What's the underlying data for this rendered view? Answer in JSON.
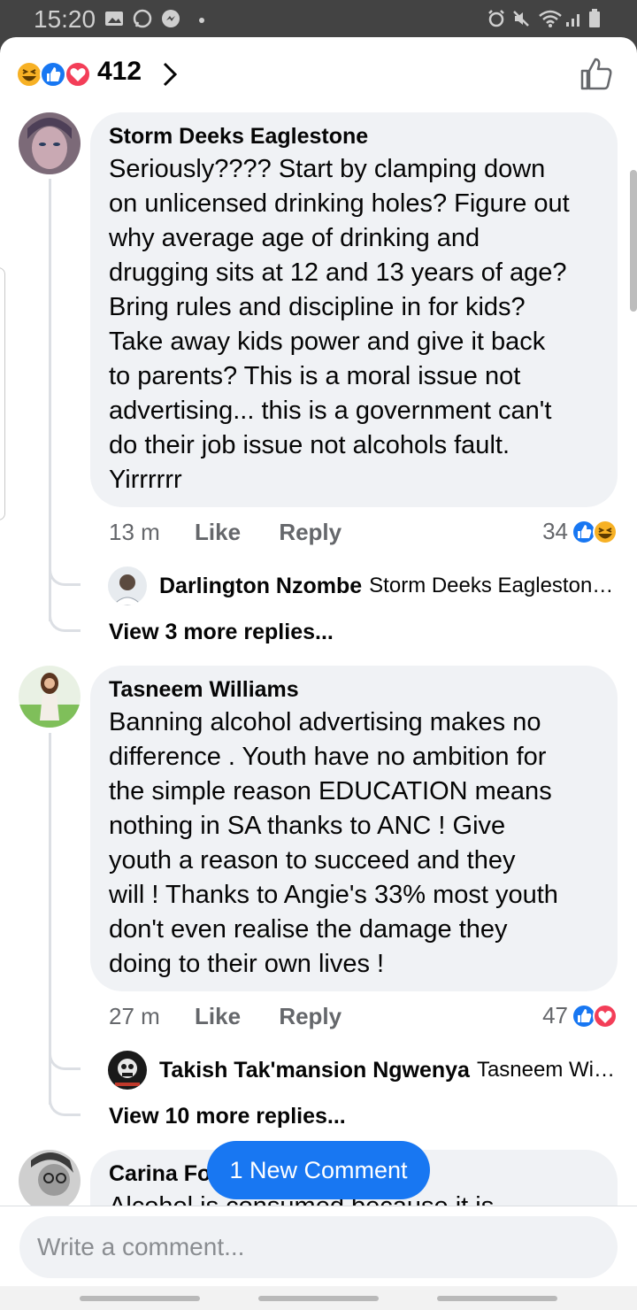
{
  "status_bar": {
    "time": "15:20"
  },
  "reactions": {
    "count": "412",
    "types": [
      "haha-icon",
      "like-icon",
      "love-icon"
    ]
  },
  "comments": [
    {
      "author": "Storm Deeks Eaglestone",
      "text": "Seriously???? Start by clamping down\non unlicensed drinking holes? Figure out\nwhy average age of drinking and\ndrugging sits at 12 and 13 years of age?\nBring rules and discipline in for kids?\nTake away kids power and give it back\nto parents? This is a moral issue not\nadvertising... this is a government can't\ndo their job issue not alcohols fault.\nYirrrrrr",
      "time": "13 m",
      "like_label": "Like",
      "reply_label": "Reply",
      "reaction_count": "34",
      "reply_preview": {
        "name": "Darlington Nzombe",
        "snippet": "Storm Deeks Eaglestone..."
      },
      "more_replies": "View 3 more replies..."
    },
    {
      "author": "Tasneem Williams",
      "text": "Banning alcohol advertising makes no\ndifference . Youth have no ambition for\nthe simple reason EDUCATION means\nnothing in SA thanks to ANC ! Give\nyouth a reason to succeed and they\nwill ! Thanks to Angie's 33% most youth\ndon't even realise the damage they\ndoing to their own lives !",
      "time": "27 m",
      "like_label": "Like",
      "reply_label": "Reply",
      "reaction_count": "47",
      "reply_preview": {
        "name": "Takish Tak'mansion Ngwenya",
        "snippet": "Tasneem Williams..."
      },
      "more_replies": "View 10 more replies..."
    },
    {
      "author": "Carina Fo",
      "text": "Alcohol is consumed because it is"
    }
  ],
  "new_comment_label": "1 New Comment",
  "composer": {
    "placeholder": "Write a comment..."
  },
  "colors": {
    "accent": "#1877f2",
    "bubble": "#f0f2f5",
    "love": "#f33e58",
    "haha": "#f7b125"
  }
}
